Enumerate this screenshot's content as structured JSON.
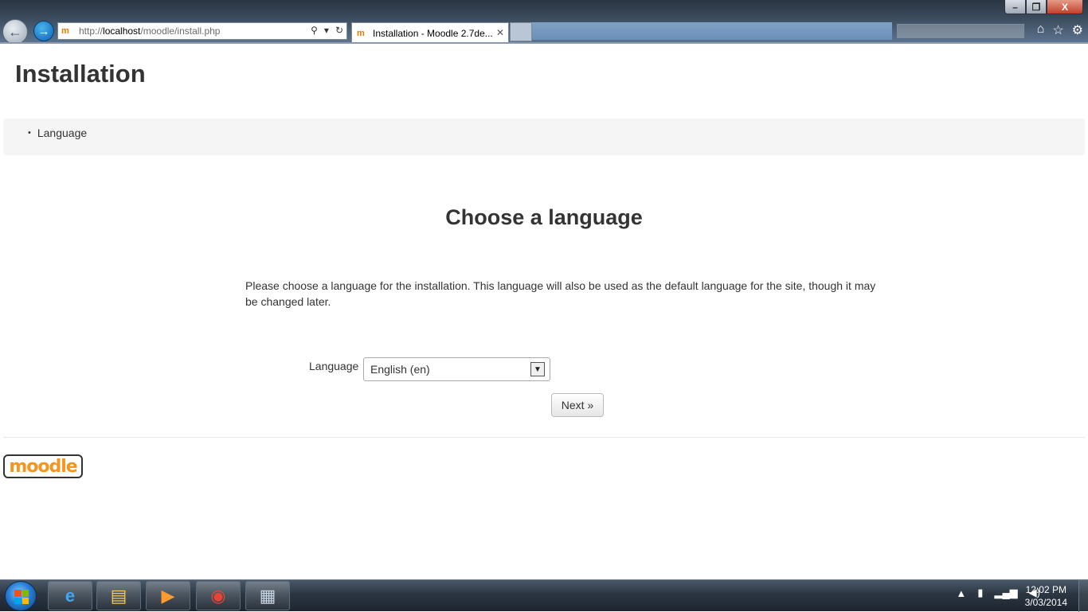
{
  "browser": {
    "url_prefix": "http://",
    "url_host": "localhost",
    "url_path": "/moodle/install.php",
    "tab_title": "Installation - Moodle 2.7de...",
    "favicon_glyph": "m",
    "window_buttons": {
      "minimize": "–",
      "maximize": "❐",
      "close": "X"
    }
  },
  "page": {
    "title": "Installation",
    "breadcrumb": "Language",
    "heading": "Choose a language",
    "intro": "Please choose a language for the installation. This language will also be used as the default language for the site, though it may be changed later.",
    "language_label": "Language",
    "language_selected": "English (en)",
    "next_button": "Next »",
    "logo_text": "moodle"
  },
  "taskbar": {
    "clock_time": "12:02 PM",
    "clock_date": "3/03/2014",
    "apps": [
      "internet-explorer",
      "file-explorer",
      "media-player",
      "chrome",
      "calculator"
    ]
  },
  "colors": {
    "page_text": "#333333",
    "breadcrumb_bg": "#f5f5f5",
    "moodle_orange": "#f7941d"
  }
}
